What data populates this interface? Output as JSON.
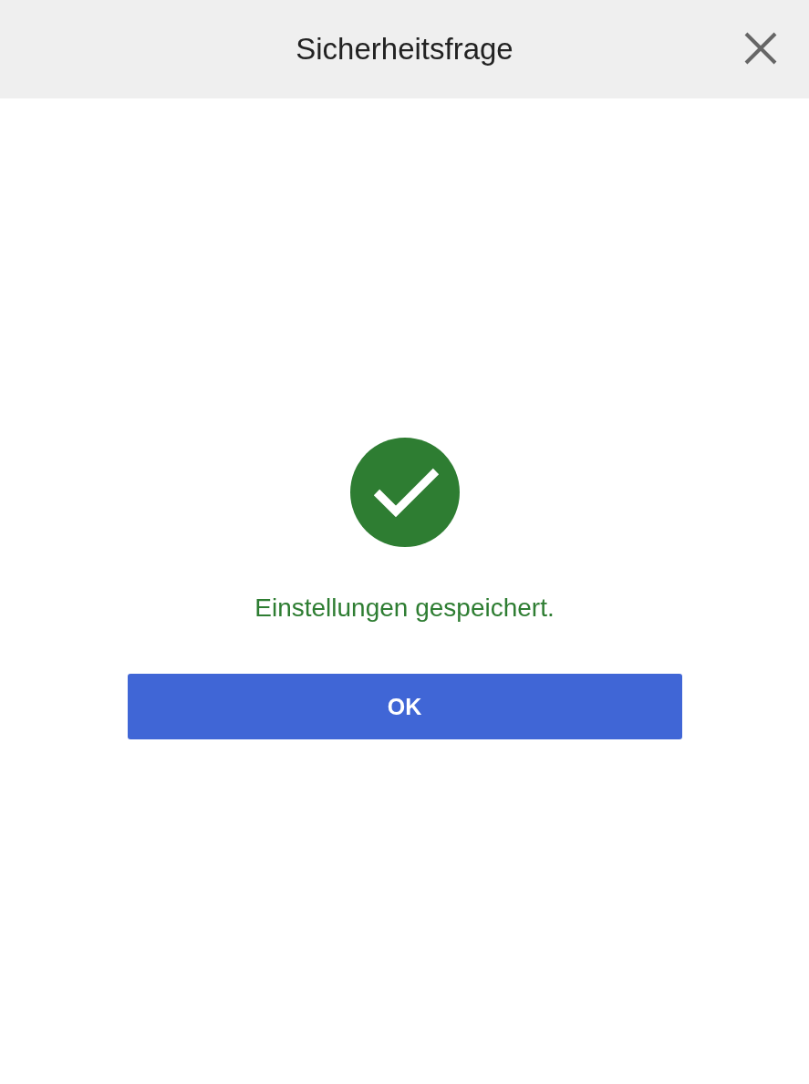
{
  "dialog": {
    "title": "Sicherheitsfrage"
  },
  "message": {
    "kind": "success",
    "text": "Einstellungen gespeichert."
  },
  "buttons": [
    {
      "label": "OK"
    }
  ]
}
